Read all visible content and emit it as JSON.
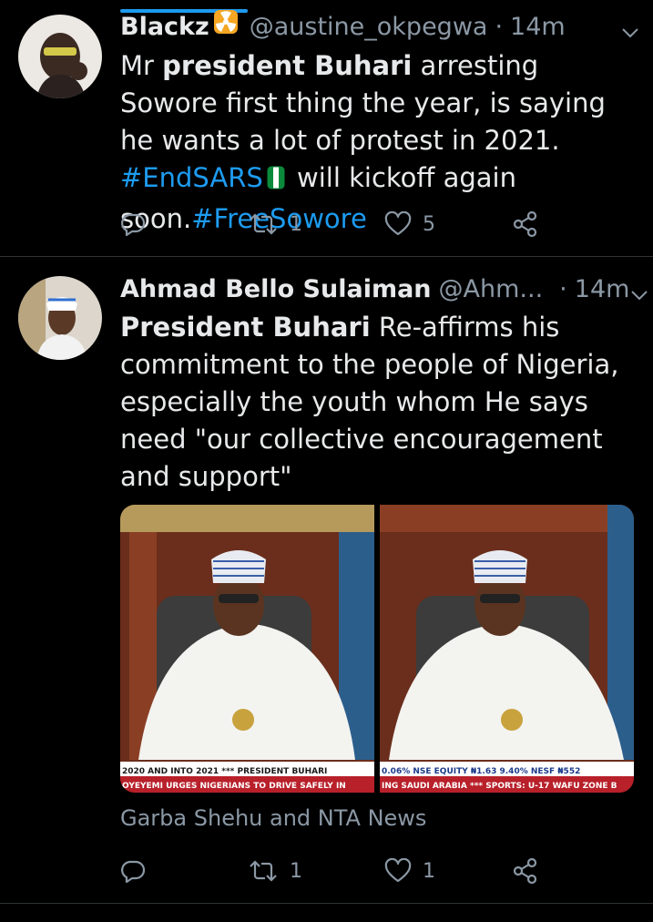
{
  "tweets": [
    {
      "display_name": "Blackz",
      "handle": "@austine_okpegwa",
      "dot": "·",
      "time": "14m",
      "text_prefix": "Mr ",
      "text_bold": "president Buhari",
      "text_mid": " arresting Sowore first thing the year, is saying he wants a lot of protest in 2021. ",
      "hashtag1": "#EndSARS",
      "text_after": " will kickoff again soon.",
      "hashtag2": "#FreeSowore",
      "retweets": "1",
      "likes": "5"
    },
    {
      "display_name": "Ahmad Bello Sulaiman",
      "handle": "@Ahm...",
      "dot": "·",
      "time": "14m",
      "text_bold": "President Buhari",
      "text_rest": " Re-affirms his commitment to the people of Nigeria, especially the youth whom He says need \"our collective encouragement and support\"",
      "media_captions": [
        {
          "line1": "2020 AND INTO 2021 *** PRESIDENT BUHARI",
          "line2": "OYEYEMI URGES NIGERIANS TO DRIVE SAFELY IN"
        },
        {
          "line1": "0.06% NSE EQUITY ₦1.63 9.40% NESF ₦552",
          "line2": "ING SAUDI ARABIA *** SPORTS: U-17 WAFU ZONE B"
        }
      ],
      "attribution": "Garba Shehu and NTA News",
      "retweets": "1",
      "likes": "1"
    }
  ],
  "colors": {
    "background": "#000000",
    "accent": "#1d9bf0",
    "secondary_text": "#8b98a5",
    "divider": "#2f3336"
  },
  "icons": [
    "reply-icon",
    "retweet-icon",
    "like-icon",
    "share-icon",
    "chevron-down-icon",
    "radioactive-emoji-icon",
    "nigeria-flag-emoji-icon"
  ]
}
